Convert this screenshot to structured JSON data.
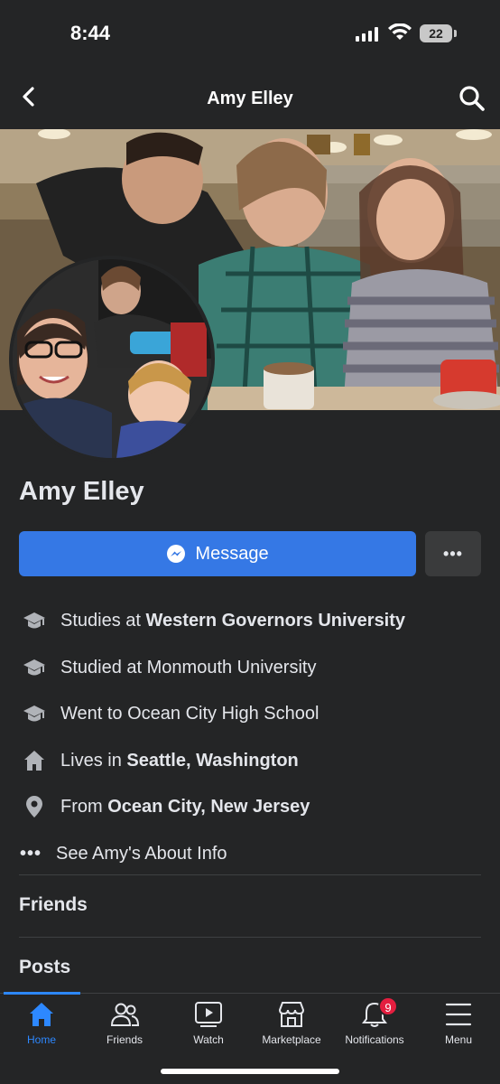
{
  "status": {
    "time": "8:44",
    "battery": "22"
  },
  "header": {
    "title": "Amy Elley"
  },
  "profile": {
    "name": "Amy Elley"
  },
  "actions": {
    "message_label": "Message",
    "more_label": "•••"
  },
  "info": [
    {
      "icon": "graduation-cap-icon",
      "prefix": "Studies at ",
      "bold": "Western Governors University"
    },
    {
      "icon": "graduation-cap-icon",
      "prefix": "Studied at Monmouth University",
      "bold": ""
    },
    {
      "icon": "graduation-cap-icon",
      "prefix": "Went to Ocean City High School",
      "bold": ""
    },
    {
      "icon": "home-icon",
      "prefix": "Lives in ",
      "bold": "Seattle, Washington"
    },
    {
      "icon": "location-pin-icon",
      "prefix": "From ",
      "bold": "Ocean City, New Jersey"
    }
  ],
  "about_link": "See Amy's About Info",
  "sections": {
    "friends": "Friends",
    "posts": "Posts"
  },
  "tabs": [
    {
      "label": "Home",
      "icon": "home-icon",
      "active": true
    },
    {
      "label": "Friends",
      "icon": "friends-icon"
    },
    {
      "label": "Watch",
      "icon": "watch-icon"
    },
    {
      "label": "Marketplace",
      "icon": "marketplace-icon"
    },
    {
      "label": "Notifications",
      "icon": "bell-icon",
      "badge": "9"
    },
    {
      "label": "Menu",
      "icon": "menu-icon"
    }
  ]
}
